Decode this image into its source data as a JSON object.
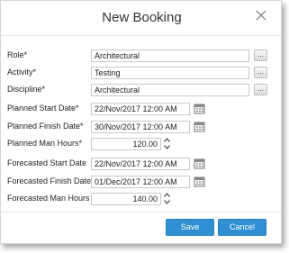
{
  "dialog": {
    "title": "New Booking",
    "close_icon": "close-icon"
  },
  "form": {
    "role": {
      "label": "Role*",
      "value": "Architectural",
      "lookup_label": "..."
    },
    "activity": {
      "label": "Activity*",
      "value": "Testing",
      "lookup_label": "..."
    },
    "discipline": {
      "label": "Discipline*",
      "value": "Architectural",
      "lookup_label": "..."
    },
    "planned_start": {
      "label": "Planned Start Date*",
      "value": "22/Nov/2017 12:00 AM",
      "icon": "calendar-icon"
    },
    "planned_finish": {
      "label": "Planned Finish Date*",
      "value": "30/Nov/2017 12:00 AM",
      "icon": "calendar-icon"
    },
    "planned_hours": {
      "label": "Planned Man Hours*",
      "value": "120.00",
      "icon": "spinner-icon"
    },
    "forecast_start": {
      "label": "Forecasted Start Date",
      "value": "22/Nov/2017 12:00 AM",
      "icon": "calendar-icon"
    },
    "forecast_finish": {
      "label": "Forecasted Finish Date",
      "value": "01/Dec/2017 12:00 AM",
      "icon": "calendar-icon"
    },
    "forecast_hours": {
      "label": "Forecasted Man Hours",
      "value": "140.00",
      "icon": "spinner-icon"
    }
  },
  "footer": {
    "save_label": "Save",
    "cancel_label": "Cancel"
  },
  "colors": {
    "primary_button": "#2e8fd3",
    "divider": "#e3e3e3"
  }
}
